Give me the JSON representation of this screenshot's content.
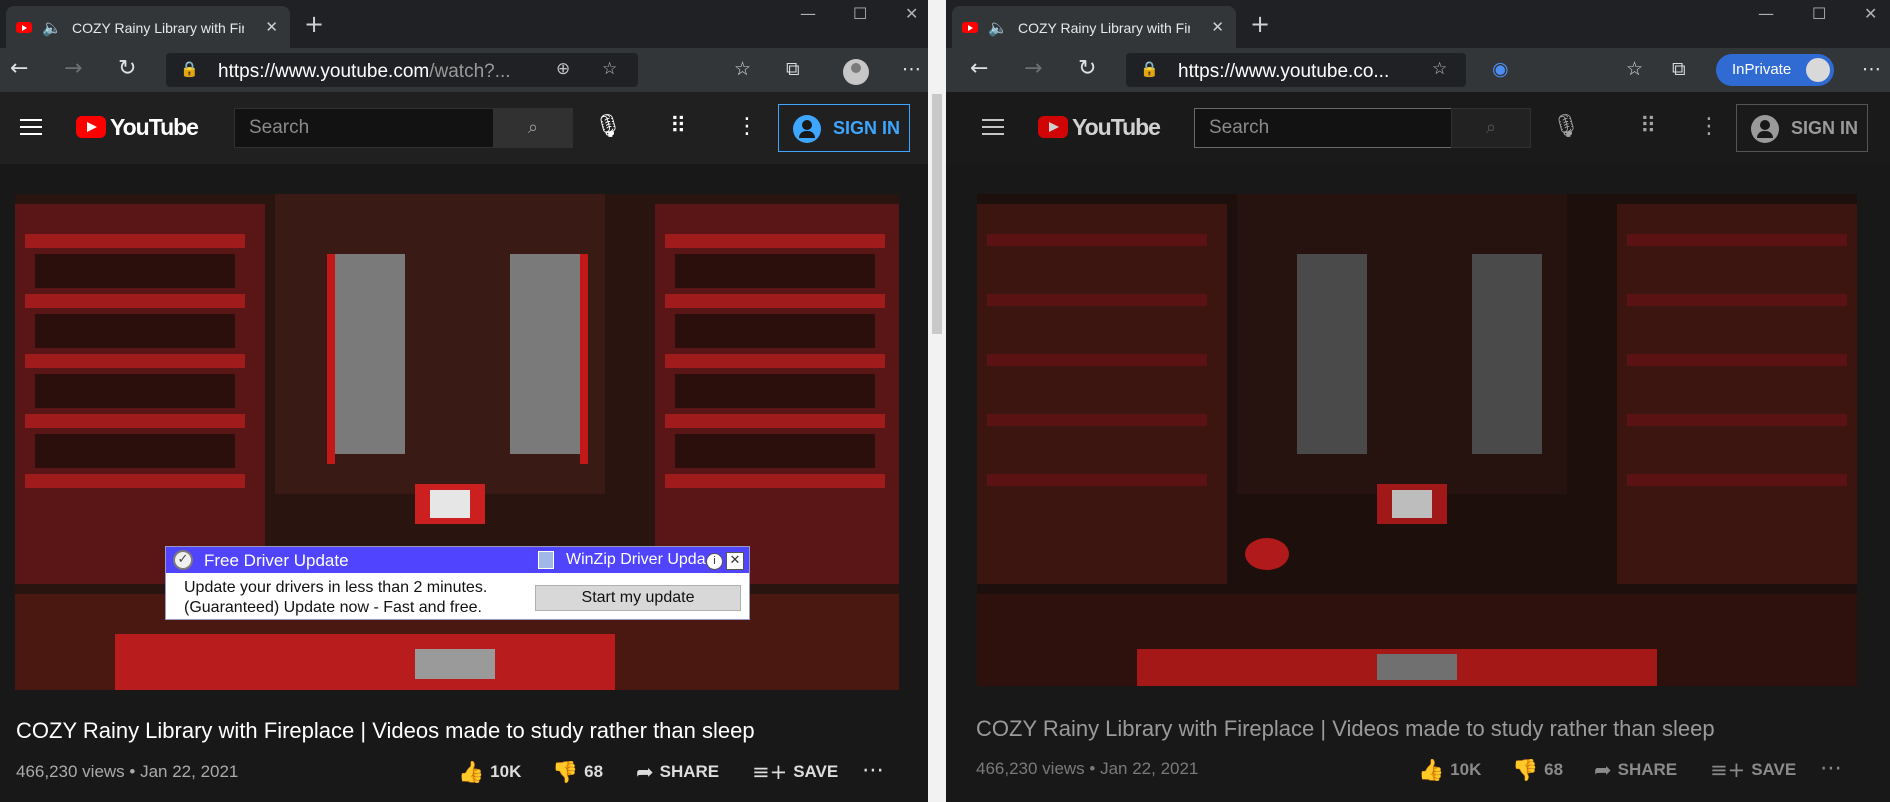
{
  "tab": {
    "title": "COZY Rainy Library with Fireplace | Videos made to study rather than sleep - YouTube"
  },
  "left": {
    "url_main": "https://www.youtube.com",
    "url_rest": "/watch?...",
    "search_placeholder": "Search",
    "sign_in": "SIGN IN"
  },
  "right": {
    "url": "https://www.youtube.co...",
    "inprivate": "InPrivate",
    "search_placeholder": "Search",
    "sign_in": "SIGN IN"
  },
  "youtube": {
    "logo_text": "YouTube"
  },
  "video": {
    "title": "COZY Rainy Library with Fireplace | Videos made to study rather than sleep",
    "views_date": "466,230 views • Jan 22, 2021",
    "likes": "10K",
    "dislikes": "68",
    "share": "SHARE",
    "save": "SAVE"
  },
  "ad": {
    "header": "Free Driver Update",
    "brand": "WinZip Driver Updater",
    "line1": "Update your drivers in less than 2 minutes.",
    "line2": "(Guaranteed) Update now - Fast and free.",
    "cta": "Start my update"
  },
  "icons": {
    "back": "arrow-left-icon",
    "forward": "arrow-right-icon",
    "refresh": "refresh-icon",
    "lock": "lock-icon",
    "favorites": "star-icon",
    "collections": "collections-icon",
    "menu": "hamburger-icon",
    "search": "search-icon",
    "mic": "microphone-icon",
    "apps": "grid-icon",
    "more": "kebab-icon",
    "like": "thumbs-up-icon",
    "dislike": "thumbs-down-icon",
    "share": "share-icon",
    "save": "playlist-add-icon"
  }
}
